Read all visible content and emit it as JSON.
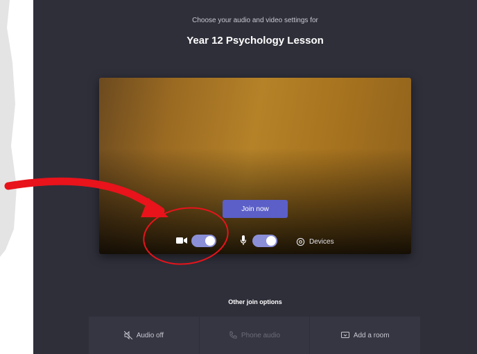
{
  "header": {
    "subtitle": "Choose your audio and video settings for",
    "meeting_title": "Year 12 Psychology Lesson"
  },
  "preview": {
    "join_label": "Join now",
    "video_toggle": {
      "state": "on",
      "icon": "video-camera-icon"
    },
    "audio_toggle": {
      "state": "on",
      "icon": "microphone-icon"
    },
    "devices_label": "Devices",
    "devices_icon": "gear-icon"
  },
  "other_options": {
    "label": "Other join options",
    "items": [
      {
        "label": "Audio off",
        "icon": "speaker-off-icon",
        "enabled": true
      },
      {
        "label": "Phone audio",
        "icon": "phone-icon",
        "enabled": false
      },
      {
        "label": "Add a room",
        "icon": "cast-icon",
        "enabled": true
      }
    ]
  },
  "colors": {
    "background": "#2f2f3a",
    "accent": "#5b5fc7",
    "toggle_on": "#8b8fd8",
    "annotation": "#e8131b"
  }
}
